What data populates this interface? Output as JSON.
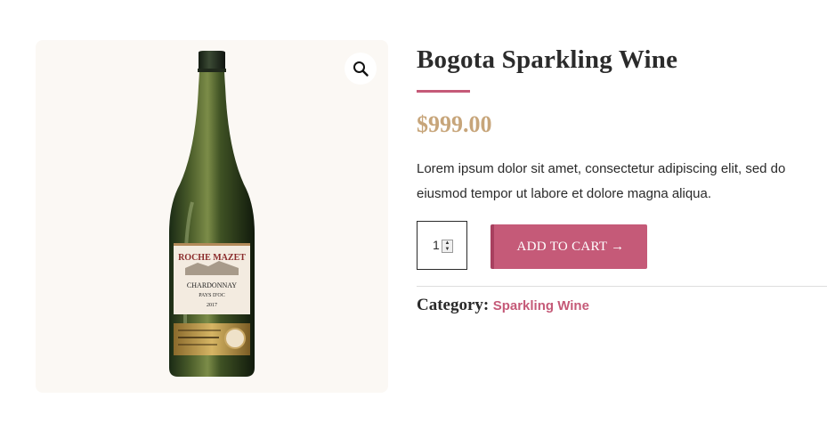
{
  "product": {
    "title": "Bogota Sparkling Wine",
    "price": "$999.00",
    "description": "Lorem ipsum dolor sit amet, consectetur adipiscing elit, sed do eiusmod tempor ut labore et dolore magna aliqua.",
    "image_alt": "Bottle of Roche Mazet Chardonnay wine",
    "label": {
      "brand": "ROCHE MAZET",
      "variety": "CHARDONNAY",
      "region": "PAYS D'OC",
      "year": "2017"
    }
  },
  "cart": {
    "quantity": "1",
    "add_button_label": "ADD TO CART →"
  },
  "meta": {
    "category_label": "Category:",
    "category_value": "Sparkling Wine"
  },
  "icons": {
    "zoom": "magnifier-icon",
    "spinner": "spinner-arrows-icon"
  },
  "colors": {
    "accent": "#c55a78",
    "price": "#c7a57a",
    "gallery_bg": "#fbf8f4"
  }
}
